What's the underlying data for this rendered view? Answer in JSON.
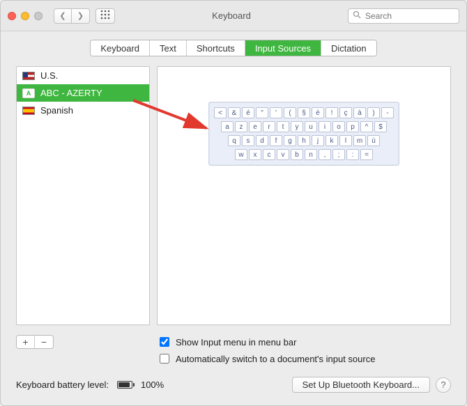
{
  "window_title": "Keyboard",
  "search_placeholder": "Search",
  "tabs": [
    "Keyboard",
    "Text",
    "Shortcuts",
    "Input Sources",
    "Dictation"
  ],
  "active_tab_index": 3,
  "sources": [
    {
      "label": "U.S.",
      "icon": "us-flag",
      "selected": false
    },
    {
      "label": "ABC - AZERTY",
      "icon": "abc-badge",
      "selected": true
    },
    {
      "label": "Spanish",
      "icon": "es-flag",
      "selected": false
    }
  ],
  "keyboard_rows": [
    [
      "<",
      "&",
      "é",
      "\"",
      "'",
      "(",
      "§",
      "è",
      "!",
      "ç",
      "à",
      ")",
      "-"
    ],
    [
      "a",
      "z",
      "e",
      "r",
      "t",
      "y",
      "u",
      "i",
      "o",
      "p",
      "^",
      "$"
    ],
    [
      "q",
      "s",
      "d",
      "f",
      "g",
      "h",
      "j",
      "k",
      "l",
      "m",
      "ù"
    ],
    [
      "w",
      "x",
      "c",
      "v",
      "b",
      "n",
      ",",
      ";",
      ":",
      "="
    ]
  ],
  "options": {
    "show_in_menubar": {
      "label": "Show Input menu in menu bar",
      "checked": true
    },
    "auto_switch": {
      "label": "Automatically switch to a document's input source",
      "checked": false
    }
  },
  "footer": {
    "battery_label": "Keyboard battery level:",
    "battery_pct": "100%",
    "bluetooth_button": "Set Up Bluetooth Keyboard..."
  },
  "abc_badge_text": "A"
}
